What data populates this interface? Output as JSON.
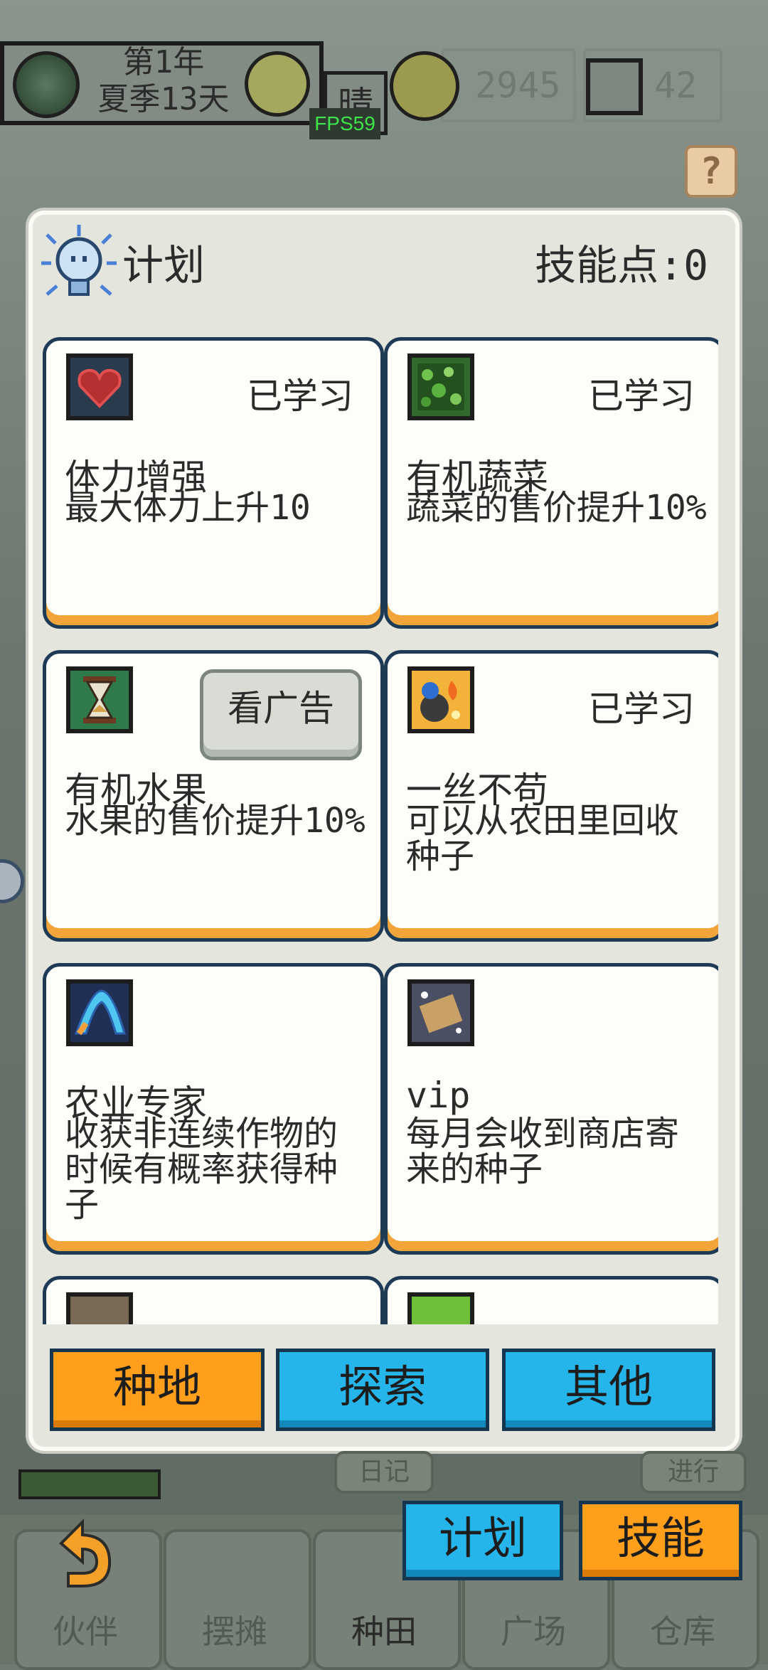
{
  "hud": {
    "year": "第1年",
    "season_day": "夏季13天",
    "weather": "晴",
    "fps": "FPS59",
    "coins": "2945",
    "gems": "42",
    "help_icon_glyph": "?"
  },
  "panel": {
    "title": "计划",
    "skill_points": "技能点:0"
  },
  "cards": [
    {
      "name": "体力增强",
      "desc": "最大体力上升10",
      "status": "已学习",
      "icon": "heart-icon",
      "icon_color": "#2a3b4d"
    },
    {
      "name": "有机蔬菜",
      "desc": "蔬菜的售价提升10%",
      "status": "已学习",
      "icon": "leaf-icon",
      "icon_color": "#2f6a2b"
    },
    {
      "name": "有机水果",
      "desc": "水果的售价提升10%",
      "action": "看广告",
      "icon": "hourglass-icon",
      "icon_color": "#2e7a4a"
    },
    {
      "name": "一丝不苟",
      "desc": "可以从农田里回收种子",
      "status": "已学习",
      "icon": "seed-bag-icon",
      "icon_color": "#f3b23a"
    },
    {
      "name": "农业专家",
      "desc": "收获非连续作物的时候有概率获得种子",
      "status": "",
      "icon": "pickaxe-icon",
      "icon_color": "#3a5aa0"
    },
    {
      "name": "vip",
      "desc": "每月会收到商店寄来的种子",
      "status": "",
      "icon": "scroll-icon",
      "icon_color": "#4a4f63"
    },
    {
      "name": "",
      "desc": "",
      "status": "",
      "icon": "book-icon",
      "icon_color": "#7a6a58"
    },
    {
      "name": "",
      "desc": "",
      "status": "",
      "icon": "sparkle-icon",
      "icon_color": "#6fbf3a"
    }
  ],
  "panel_tabs": [
    "种地",
    "探索",
    "其他"
  ],
  "side_buttons": [
    "日记",
    "进行"
  ],
  "mode_buttons": [
    "计划",
    "技能"
  ],
  "bottom_nav": [
    "伙伴",
    "摆摊",
    "种田",
    "广场",
    "仓库"
  ]
}
